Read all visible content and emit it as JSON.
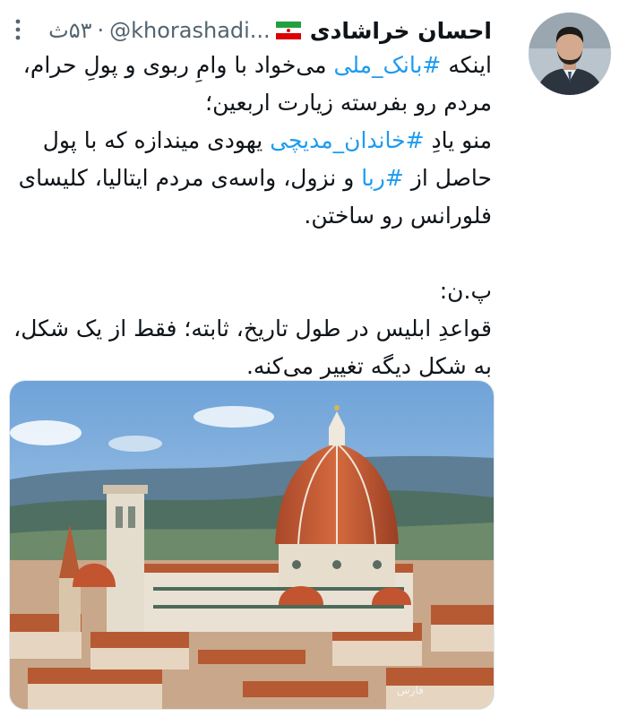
{
  "author": {
    "display_name": "احسان خراشادی",
    "flag_icon": "iran-flag-icon",
    "handle": "@khorashadi...",
    "separator": "·",
    "time": "۵۳ث"
  },
  "tweet": {
    "line_1a": "اینکه ",
    "hashtag_1": "#بانک_ملی",
    "line_1b": " می‌خواد با وامِ ربوی و پولِ حرام، مردم رو بفرسته زیارت اربعین؛",
    "line_2a": "منو یادِ ",
    "hashtag_2": "#خاندان_مدیچی",
    "line_2b": " یهودی میندازه که با پول حاصل از ",
    "hashtag_3": "#ربا",
    "line_2c": " و نزول، واسه‌ی مردم ایتالیا، کلیسای فلورانس رو ساختن.",
    "ps_label": "پ.ن:",
    "ps_text": "قواعدِ ابلیس در طول تاریخ، ثابته؛ فقط از یک شکل، به شکل دیگه تغییر می‌کنه."
  },
  "media": {
    "description_icon": "florence-cathedral-image",
    "watermark": "فارس"
  },
  "colors": {
    "link": "#1d9bf0",
    "secondary_text": "#536471",
    "primary_text": "#0f1419"
  }
}
